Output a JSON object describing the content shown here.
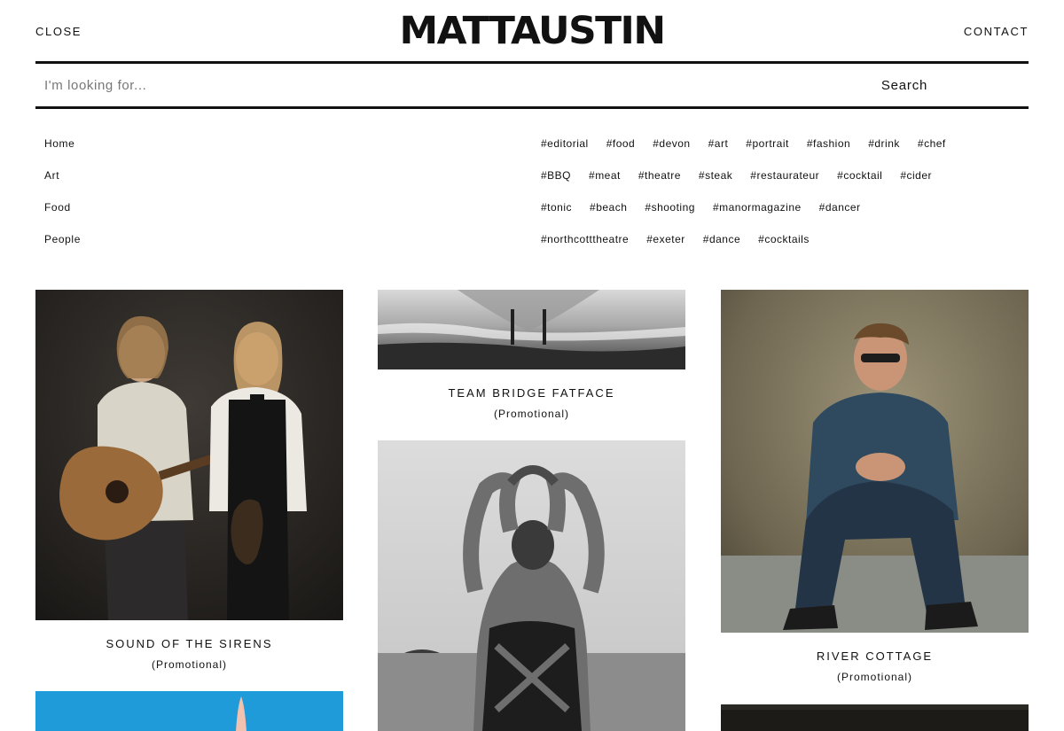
{
  "header": {
    "close_label": "CLOSE",
    "logo_text": "MATTAUSTIN",
    "contact_label": "CONTACT"
  },
  "search": {
    "placeholder": "I'm looking for...",
    "value": "",
    "button_label": "Search"
  },
  "menu": {
    "items": [
      {
        "label": "Home"
      },
      {
        "label": "Art"
      },
      {
        "label": "Food"
      },
      {
        "label": "People"
      }
    ]
  },
  "tags": {
    "rows": [
      [
        "#editorial",
        "#food",
        "#devon",
        "#art",
        "#portrait",
        "#fashion",
        "#drink",
        "#chef"
      ],
      [
        "#BBQ",
        "#meat",
        "#theatre",
        "#steak",
        "#restaurateur",
        "#cocktail",
        "#cider"
      ],
      [
        "#tonic",
        "#beach",
        "#shooting",
        "#manormagazine",
        "#dancer"
      ],
      [
        "#northcotttheatre",
        "#exeter",
        "#dance",
        "#cocktails"
      ]
    ]
  },
  "grid": {
    "items": [
      {
        "title": "SOUND OF THE SIRENS",
        "category": "(Promotional)"
      },
      {
        "title": "TEAM BRIDGE FATFACE",
        "category": "(Promotional)"
      },
      {
        "title": "RIVER COTTAGE",
        "category": "(Promotional)"
      }
    ]
  }
}
